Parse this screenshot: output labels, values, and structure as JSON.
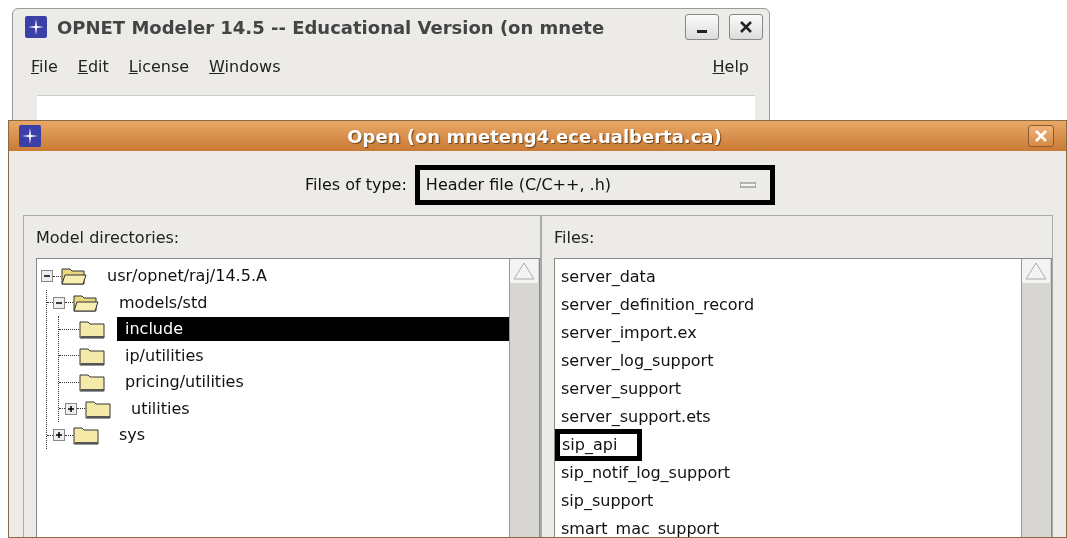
{
  "main_window": {
    "title": "OPNET Modeler 14.5 -- Educational Version (on mnete",
    "menu": [
      {
        "mnemonic": "F",
        "rest": "ile"
      },
      {
        "mnemonic": "E",
        "rest": "dit"
      },
      {
        "mnemonic": "L",
        "rest": "icense"
      },
      {
        "mnemonic": "W",
        "rest": "indows"
      }
    ],
    "help_menu": {
      "mnemonic": "H",
      "rest": "elp"
    }
  },
  "dialog": {
    "title": "Open (on mneteng4.ece.ualberta.ca)",
    "file_type": {
      "label": "Files of type:",
      "value": "Header file (C/C++, .h)",
      "outlined": true
    },
    "directories": {
      "label": "Model directories:",
      "tree": [
        {
          "label": "usr/opnet/raj/14.5.A",
          "expanded": true,
          "selected": false,
          "children": [
            {
              "label": "models/std",
              "expanded": true,
              "selected": false,
              "children": [
                {
                  "label": "include",
                  "selected": true
                },
                {
                  "label": "ip/utilities",
                  "selected": false
                },
                {
                  "label": "pricing/utilities",
                  "selected": false
                },
                {
                  "label": "utilities",
                  "expanded": false,
                  "selected": false
                }
              ]
            },
            {
              "label": "sys",
              "expanded": false,
              "selected": false
            }
          ]
        }
      ]
    },
    "files": {
      "label": "Files:",
      "items": [
        {
          "name": "server_data",
          "outlined": false
        },
        {
          "name": "server_definition_record",
          "outlined": false
        },
        {
          "name": "server_import.ex",
          "outlined": false
        },
        {
          "name": "server_log_support",
          "outlined": false
        },
        {
          "name": "server_support",
          "outlined": false
        },
        {
          "name": "server_support.ets",
          "outlined": false
        },
        {
          "name": "sip_api",
          "outlined": true
        },
        {
          "name": "sip_notif_log_support",
          "outlined": false
        },
        {
          "name": "sip_support",
          "outlined": false
        },
        {
          "name": "smart_mac_support",
          "outlined": false
        }
      ]
    }
  }
}
